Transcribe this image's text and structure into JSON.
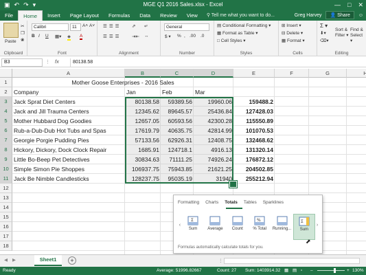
{
  "window": {
    "title": "MGE Q1 2016 Sales.xlsx - Excel",
    "user": "Greg Harvey",
    "share": "Share",
    "controls": [
      "—",
      "□",
      "✕"
    ],
    "qat": [
      "▣",
      "↶",
      "↷",
      "▾"
    ]
  },
  "tabs": [
    "File",
    "Home",
    "Insert",
    "Page Layout",
    "Formulas",
    "Data",
    "Review",
    "View",
    "Help"
  ],
  "tell_me": "Tell me what you want to do...",
  "ribbon": {
    "clipboard": {
      "label": "Clipboard",
      "paste": "Paste"
    },
    "font": {
      "label": "Font",
      "font_name": "Calibri",
      "font_size": "11",
      "bold": "B",
      "italic": "I",
      "underline": "U",
      "grow": "A˄",
      "shrink": "A˅"
    },
    "alignment": {
      "label": "Alignment"
    },
    "number": {
      "label": "Number",
      "format": "General",
      "currency": "$ ▾",
      "percent": "%",
      "comma": ",",
      "dec_inc": ".00",
      "dec_dec": ".0"
    },
    "styles": {
      "label": "Styles",
      "conditional": "Conditional Formatting ▾",
      "table": "Format as Table ▾",
      "cell_styles": "Cell Styles ▾"
    },
    "cells": {
      "label": "Cells",
      "insert": "Insert ▾",
      "delete": "Delete ▾",
      "format": "Format ▾"
    },
    "editing": {
      "label": "Editing",
      "sigma": "Σ ▾",
      "sort": "Sort & Filter ▾",
      "find": "Find & Select ▾"
    }
  },
  "formula_bar": {
    "name_box": "B3",
    "fx": "fx",
    "value": "80138.58"
  },
  "columns": [
    "A",
    "B",
    "C",
    "D",
    "E",
    "F",
    "G",
    "H"
  ],
  "rows": [
    "1",
    "2",
    "3",
    "4",
    "5",
    "6",
    "7",
    "8",
    "9",
    "10",
    "11",
    "12",
    "13",
    "14",
    "15",
    "16",
    "17",
    "18"
  ],
  "sheet": {
    "title": "Mother Goose Enterprises - 2016 Sales",
    "headers": [
      "Company",
      "Jan",
      "Feb",
      "Mar"
    ],
    "data": [
      [
        "Jack Sprat Diet Centers",
        "80138.58",
        "59389.56",
        "19960.06",
        "159488.2"
      ],
      [
        "Jack and Jill Trauma Centers",
        "12345.62",
        "89645.57",
        "25436.84",
        "127428.03"
      ],
      [
        "Mother Hubbard Dog Goodies",
        "12657.05",
        "60593.56",
        "42300.28",
        "115550.89"
      ],
      [
        "Rub-a-Dub-Dub Hot Tubs and Spas",
        "17619.79",
        "40635.75",
        "42814.99",
        "101070.53"
      ],
      [
        "Georgie Porgie Pudding Pies",
        "57133.56",
        "62926.31",
        "12408.75",
        "132468.62"
      ],
      [
        "Hickory, Dickory,  Dock Clock Repair",
        "1685.91",
        "124718.1",
        "4916.13",
        "131320.14"
      ],
      [
        "Little Bo-Beep Pet Detectives",
        "30834.63",
        "71111.25",
        "74926.24",
        "176872.12"
      ],
      [
        "Simple Simon Pie Shoppes",
        "106937.75",
        "75943.85",
        "21621.25",
        "204502.85"
      ],
      [
        "Jack Be Nimble Candlesticks",
        "128237.75",
        "95035.19",
        "31940",
        "255212.94"
      ]
    ]
  },
  "quick_analysis": {
    "tabs": [
      "Formatting",
      "Charts",
      "Totals",
      "Tables",
      "Sparklines"
    ],
    "active_tab": "Totals",
    "items": [
      "Sum",
      "Average",
      "Count",
      "% Total",
      "Running...",
      "Sum"
    ],
    "description": "Formulas automatically calculate totals for you."
  },
  "sheet_tabs": {
    "active": "Sheet1",
    "add": "+"
  },
  "status_bar": {
    "ready": "Ready",
    "average": "Average: 51996.82667",
    "count": "Count: 27",
    "sum": "Sum: 1403914.32",
    "zoom": "130%"
  },
  "colors": {
    "accent": "#217346"
  }
}
